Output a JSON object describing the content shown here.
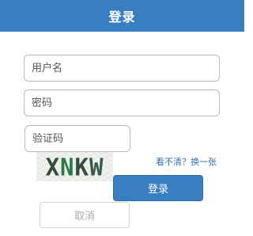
{
  "header": {
    "title": "登录"
  },
  "form": {
    "username_placeholder": "用户名",
    "password_placeholder": "密码",
    "captcha_placeholder": "验证码",
    "captcha_text": [
      "X",
      "N",
      "K",
      "W"
    ],
    "refresh_link": "看不清？换一张",
    "login_button": "登录",
    "cancel_button": "取消"
  },
  "colors": {
    "header_bg": "#3a7ec2",
    "primary_button": "#3a7ec2",
    "link": "#2f6fb0"
  }
}
